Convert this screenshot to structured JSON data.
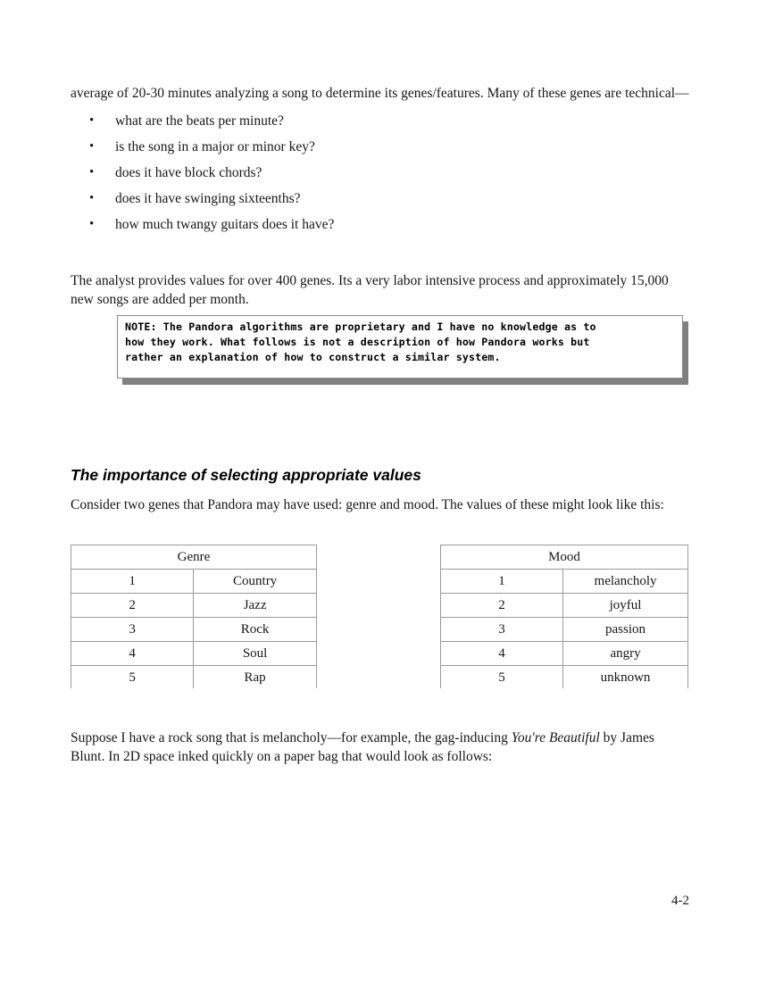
{
  "document": {
    "page_number": "4-2"
  },
  "paragraphs": {
    "intro": "average of 20-30 minutes analyzing a song to determine its genes/features.  Many of these genes are technical—",
    "analyst": "The analyst provides values for over 400 genes. Its a very labor intensive process and approximately 15,000 new songs are added per month.",
    "consider": "Consider two genes that Pandora may have used: genre and mood. The values of these might look like this:",
    "suppose_part1": "Suppose I have a rock song that is melancholy—for example, the gag-inducing ",
    "suppose_italic": "You're Beautiful",
    "suppose_part2": " by James Blunt.  In 2D space inked quickly on a paper bag that would look as follows:"
  },
  "bullets": {
    "marker": "•",
    "items": [
      "what are the beats per minute?",
      "is the song in a major or minor key?",
      "does it have block chords?",
      "does it have swinging sixteenths?",
      "how much twangy guitars does it have?"
    ]
  },
  "note_box": {
    "lines": [
      "NOTE: The Pandora algorithms are proprietary and I have no knowledge as to",
      "how they work. What follows is not a description of how Pandora works but",
      "rather an explanation of how to construct a similar system.",
      ""
    ],
    "shadow_color": "#808080",
    "border_color": "#8a8a8a"
  },
  "section": {
    "heading": "The importance of selecting appropriate values"
  },
  "tables": {
    "genre": {
      "title": "Genre",
      "rows": [
        {
          "num": "1",
          "value": "Country"
        },
        {
          "num": "2",
          "value": "Jazz"
        },
        {
          "num": "3",
          "value": "Rock"
        },
        {
          "num": "4",
          "value": "Soul"
        },
        {
          "num": "5",
          "value": "Rap"
        }
      ]
    },
    "mood": {
      "title": "Mood",
      "rows": [
        {
          "num": "1",
          "value": "melancholy"
        },
        {
          "num": "2",
          "value": "joyful"
        },
        {
          "num": "3",
          "value": "passion"
        },
        {
          "num": "4",
          "value": "angry"
        },
        {
          "num": "5",
          "value": "unknown"
        }
      ]
    }
  }
}
